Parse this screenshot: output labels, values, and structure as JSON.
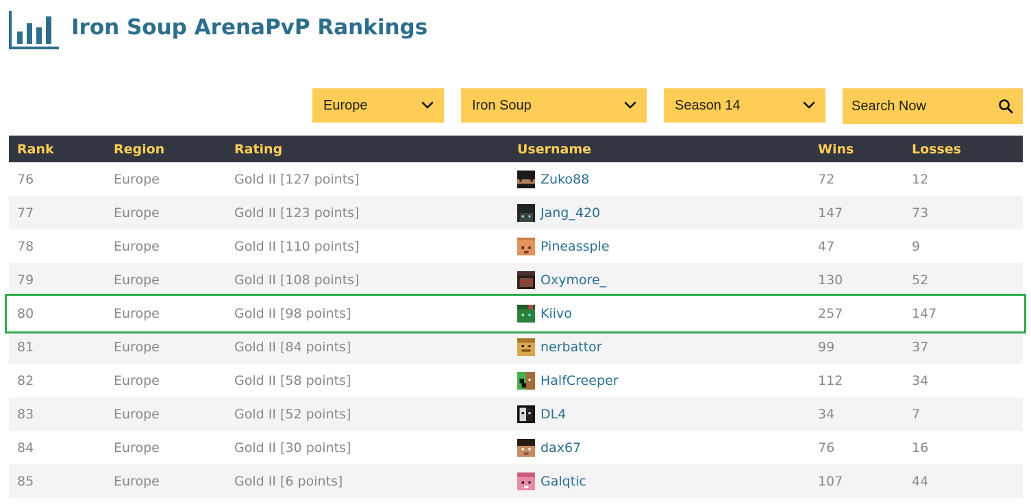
{
  "header": {
    "title": "Iron Soup ArenaPvP Rankings",
    "logo_icon": "bar-chart-icon"
  },
  "filters": {
    "region": {
      "value": "Europe",
      "icon": "chevron-down-icon"
    },
    "ladder": {
      "value": "Iron Soup",
      "icon": "chevron-down-icon"
    },
    "season": {
      "value": "Season 14",
      "icon": "chevron-down-icon"
    },
    "search": {
      "placeholder": "Search Now",
      "icon": "search-icon"
    }
  },
  "colors": {
    "accent": "#fecd55",
    "title": "#2c6e8c",
    "header_bg": "#323641",
    "link": "#2a7091",
    "highlight": "#2eab4e"
  },
  "table": {
    "columns": [
      "Rank",
      "Region",
      "Rating",
      "Username",
      "Wins",
      "Losses"
    ],
    "highlighted_rank": "80",
    "rows": [
      {
        "rank": "76",
        "region": "Europe",
        "rating": "Gold II [127 points]",
        "username": "Zuko88",
        "wins": "72",
        "losses": "12",
        "avatar": "zuko-avatar"
      },
      {
        "rank": "77",
        "region": "Europe",
        "rating": "Gold II [123 points]",
        "username": "Jang_420",
        "wins": "147",
        "losses": "73",
        "avatar": "jang-avatar"
      },
      {
        "rank": "78",
        "region": "Europe",
        "rating": "Gold II [110 points]",
        "username": "Pineassple",
        "wins": "47",
        "losses": "9",
        "avatar": "pineassple-avatar"
      },
      {
        "rank": "79",
        "region": "Europe",
        "rating": "Gold II [108 points]",
        "username": "Oxymore_",
        "wins": "130",
        "losses": "52",
        "avatar": "oxymore-avatar"
      },
      {
        "rank": "80",
        "region": "Europe",
        "rating": "Gold II [98 points]",
        "username": "Kiivo",
        "wins": "257",
        "losses": "147",
        "avatar": "kiivo-avatar"
      },
      {
        "rank": "81",
        "region": "Europe",
        "rating": "Gold II [84 points]",
        "username": "nerbattor",
        "wins": "99",
        "losses": "37",
        "avatar": "nerbattor-avatar"
      },
      {
        "rank": "82",
        "region": "Europe",
        "rating": "Gold II [58 points]",
        "username": "HalfCreeper",
        "wins": "112",
        "losses": "34",
        "avatar": "halfcreeper-avatar"
      },
      {
        "rank": "83",
        "region": "Europe",
        "rating": "Gold II [52 points]",
        "username": "DL4",
        "wins": "34",
        "losses": "7",
        "avatar": "dl4-avatar"
      },
      {
        "rank": "84",
        "region": "Europe",
        "rating": "Gold II [30 points]",
        "username": "dax67",
        "wins": "76",
        "losses": "16",
        "avatar": "dax67-avatar"
      },
      {
        "rank": "85",
        "region": "Europe",
        "rating": "Gold II [6 points]",
        "username": "Galqtic",
        "wins": "107",
        "losses": "44",
        "avatar": "galqtic-avatar"
      }
    ]
  }
}
